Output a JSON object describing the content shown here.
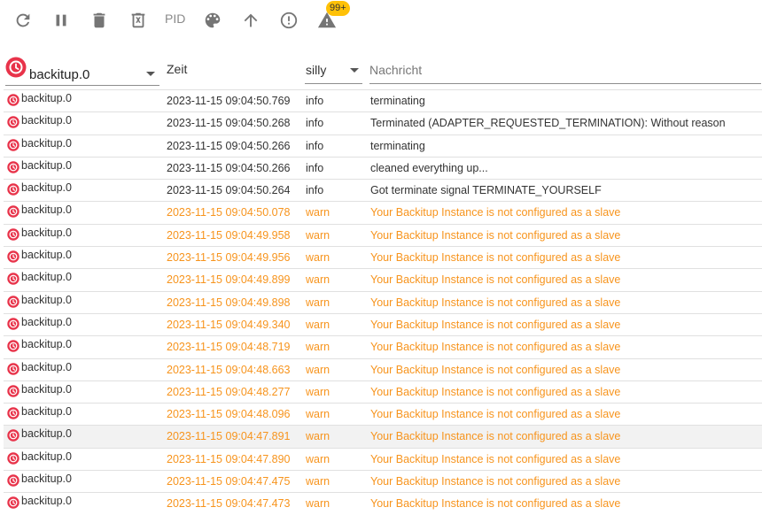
{
  "toolbar": {
    "pid_label": "PID",
    "badge_count": "99+",
    "icons": [
      "refresh-icon",
      "pause-icon",
      "delete-icon",
      "delete-x-icon",
      "palette-icon",
      "arrow-up-icon",
      "error-icon",
      "warning-icon"
    ]
  },
  "filters": {
    "adapter_value": "backitup.0",
    "time_header": "Zeit",
    "level_value": "silly",
    "message_placeholder": "Nachricht"
  },
  "colors": {
    "warn": "#f7941d",
    "info": "#333333",
    "logo": "#e8334a",
    "badge": "#ffc107"
  },
  "rows": [
    {
      "source": "backitup.0",
      "time": "2023-11-15 09:04:50.769",
      "level": "info",
      "message": "terminating"
    },
    {
      "source": "backitup.0",
      "time": "2023-11-15 09:04:50.268",
      "level": "info",
      "message": "Terminated (ADAPTER_REQUESTED_TERMINATION): Without reason"
    },
    {
      "source": "backitup.0",
      "time": "2023-11-15 09:04:50.266",
      "level": "info",
      "message": "terminating"
    },
    {
      "source": "backitup.0",
      "time": "2023-11-15 09:04:50.266",
      "level": "info",
      "message": "cleaned everything up..."
    },
    {
      "source": "backitup.0",
      "time": "2023-11-15 09:04:50.264",
      "level": "info",
      "message": "Got terminate signal TERMINATE_YOURSELF"
    },
    {
      "source": "backitup.0",
      "time": "2023-11-15 09:04:50.078",
      "level": "warn",
      "message": "Your Backitup Instance is not configured as a slave"
    },
    {
      "source": "backitup.0",
      "time": "2023-11-15 09:04:49.958",
      "level": "warn",
      "message": "Your Backitup Instance is not configured as a slave"
    },
    {
      "source": "backitup.0",
      "time": "2023-11-15 09:04:49.956",
      "level": "warn",
      "message": "Your Backitup Instance is not configured as a slave"
    },
    {
      "source": "backitup.0",
      "time": "2023-11-15 09:04:49.899",
      "level": "warn",
      "message": "Your Backitup Instance is not configured as a slave"
    },
    {
      "source": "backitup.0",
      "time": "2023-11-15 09:04:49.898",
      "level": "warn",
      "message": "Your Backitup Instance is not configured as a slave"
    },
    {
      "source": "backitup.0",
      "time": "2023-11-15 09:04:49.340",
      "level": "warn",
      "message": "Your Backitup Instance is not configured as a slave"
    },
    {
      "source": "backitup.0",
      "time": "2023-11-15 09:04:48.719",
      "level": "warn",
      "message": "Your Backitup Instance is not configured as a slave"
    },
    {
      "source": "backitup.0",
      "time": "2023-11-15 09:04:48.663",
      "level": "warn",
      "message": "Your Backitup Instance is not configured as a slave"
    },
    {
      "source": "backitup.0",
      "time": "2023-11-15 09:04:48.277",
      "level": "warn",
      "message": "Your Backitup Instance is not configured as a slave"
    },
    {
      "source": "backitup.0",
      "time": "2023-11-15 09:04:48.096",
      "level": "warn",
      "message": "Your Backitup Instance is not configured as a slave"
    },
    {
      "source": "backitup.0",
      "time": "2023-11-15 09:04:47.891",
      "level": "warn",
      "message": "Your Backitup Instance is not configured as a slave",
      "highlighted": true
    },
    {
      "source": "backitup.0",
      "time": "2023-11-15 09:04:47.890",
      "level": "warn",
      "message": "Your Backitup Instance is not configured as a slave"
    },
    {
      "source": "backitup.0",
      "time": "2023-11-15 09:04:47.475",
      "level": "warn",
      "message": "Your Backitup Instance is not configured as a slave"
    },
    {
      "source": "backitup.0",
      "time": "2023-11-15 09:04:47.473",
      "level": "warn",
      "message": "Your Backitup Instance is not configured as a slave"
    }
  ]
}
